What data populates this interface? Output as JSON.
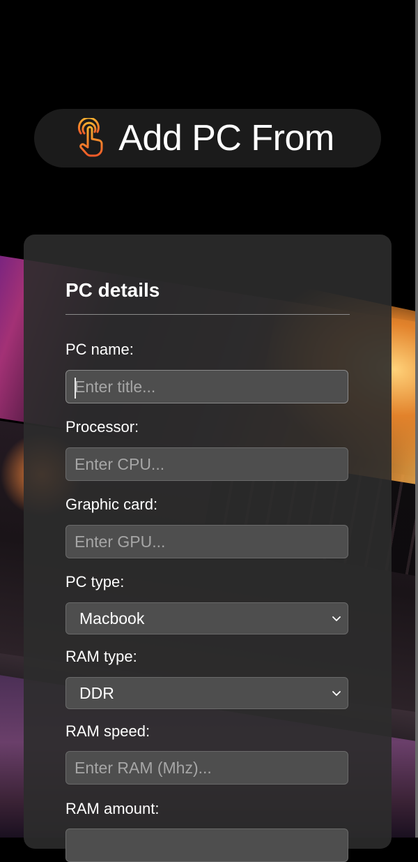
{
  "header": {
    "title": "Add PC From",
    "icon": "tap-hand-icon",
    "icon_colors": [
      "#f5b12f",
      "#f05a28"
    ]
  },
  "form": {
    "section_title": "PC details",
    "fields": {
      "pc_name": {
        "label": "PC name:",
        "placeholder": "Enter title..."
      },
      "processor": {
        "label": "Processor:",
        "placeholder": "Enter CPU..."
      },
      "graphic_card": {
        "label": "Graphic card:",
        "placeholder": "Enter GPU..."
      },
      "pc_type": {
        "label": "PC type:",
        "value": "Macbook"
      },
      "ram_type": {
        "label": "RAM type:",
        "value": "DDR"
      },
      "ram_speed": {
        "label": "RAM speed:",
        "placeholder": "Enter RAM (Mhz)..."
      },
      "ram_amount": {
        "label": "RAM amount:"
      }
    }
  },
  "theme": {
    "card_bg": "#2c2c2c",
    "input_bg": "#4e4e4e",
    "placeholder_color": "#a6a6a6"
  }
}
